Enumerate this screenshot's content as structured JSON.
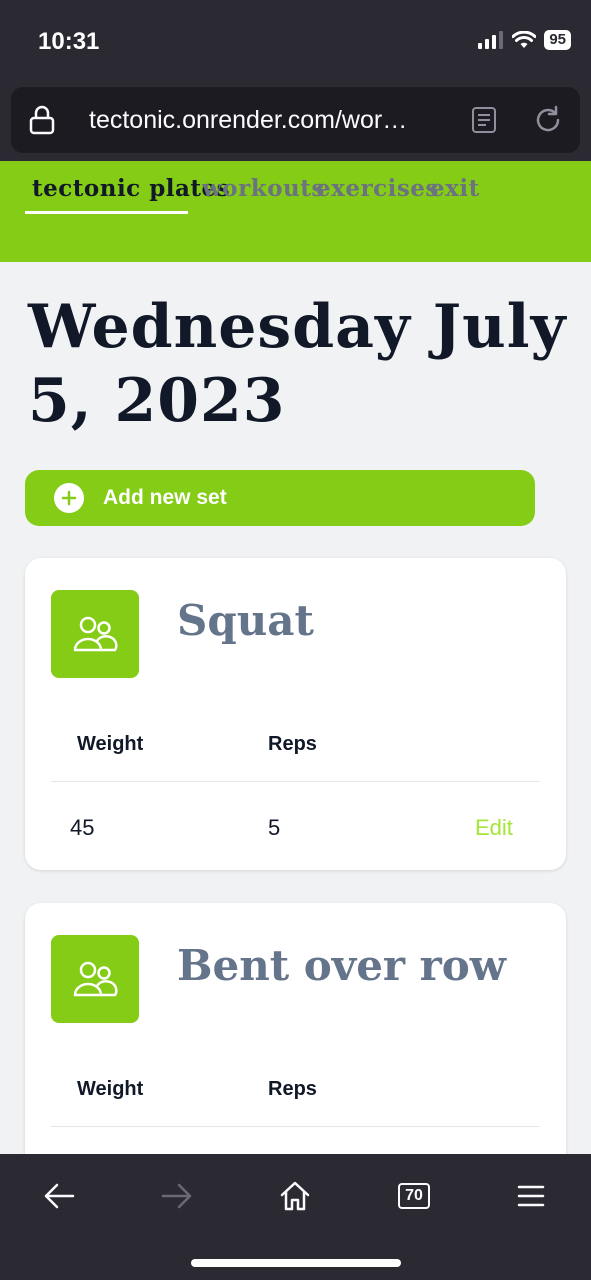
{
  "status_bar": {
    "time": "10:31",
    "battery": "95"
  },
  "browser": {
    "url": "tectonic.onrender.com/wor…",
    "tab_count": "70"
  },
  "nav": {
    "brand": "tectonic plates",
    "links": [
      "workouts",
      "exercises",
      "exit"
    ]
  },
  "page": {
    "title": "Wednesday July 5, 2023",
    "add_button": "Add new set"
  },
  "exercises": [
    {
      "name": "Squat",
      "headers": [
        "Weight",
        "Reps"
      ],
      "rows": [
        {
          "weight": "45",
          "reps": "5",
          "action": "Edit"
        }
      ]
    },
    {
      "name": "Bent over row",
      "headers": [
        "Weight",
        "Reps"
      ],
      "rows": []
    }
  ],
  "colors": {
    "accent": "#84cc16",
    "chrome": "#2b2a33",
    "title": "#111827",
    "muted": "#64748b",
    "edit": "#a3e635"
  },
  "icons": [
    "lock-icon",
    "reader-mode-icon",
    "reload-icon",
    "plus-circle-icon",
    "users-icon",
    "back-icon",
    "forward-icon",
    "home-icon",
    "tabs-icon",
    "menu-icon",
    "signal-icon",
    "wifi-icon"
  ]
}
